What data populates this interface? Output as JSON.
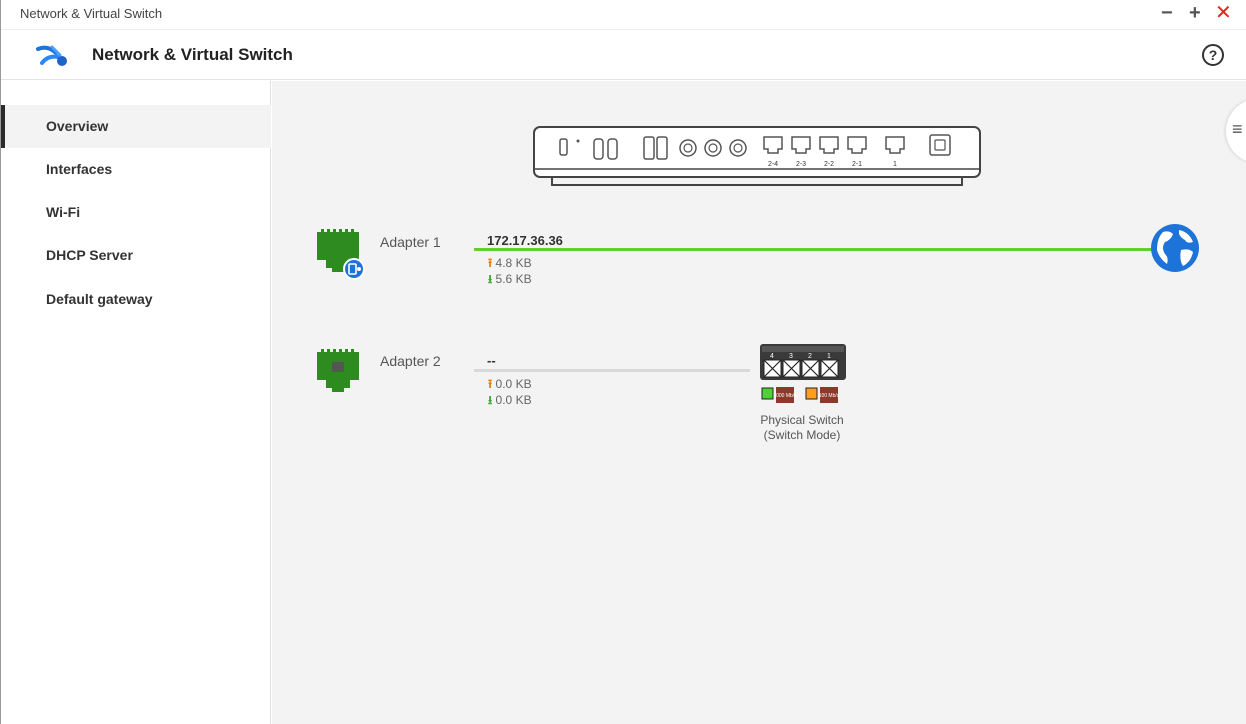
{
  "window": {
    "title": "Network & Virtual Switch",
    "minimize": "−",
    "maximize": "+",
    "close": "✕"
  },
  "header": {
    "app_title": "Network & Virtual Switch",
    "help_label": "?"
  },
  "sidebar": {
    "items": [
      {
        "label": "Overview",
        "active": true
      },
      {
        "label": "Interfaces",
        "active": false
      },
      {
        "label": "Wi-Fi",
        "active": false
      },
      {
        "label": "DHCP Server",
        "active": false
      },
      {
        "label": "Default gateway",
        "active": false
      }
    ]
  },
  "device": {
    "port_labels": [
      "2-4",
      "2-3",
      "2-2",
      "2-1",
      "1"
    ]
  },
  "adapters": [
    {
      "name": "Adapter 1",
      "ip": "172.17.36.36",
      "upload": "4.8 KB",
      "download": "5.6 KB",
      "status": "connected",
      "destination": "globe-icon"
    },
    {
      "name": "Adapter 2",
      "ip": "--",
      "upload": "0.0 KB",
      "download": "0.0 KB",
      "status": "idle",
      "destination": "physical-switch-icon"
    }
  ],
  "physical_switch": {
    "port_numbers": [
      "4",
      "3",
      "2",
      "1"
    ],
    "legend_green": "1000 Mb/s",
    "legend_orange": "100 Mb/s",
    "label_line1": "Physical Switch",
    "label_line2": "(Switch Mode)"
  },
  "icons": {
    "up_arrow": "⭱",
    "down_arrow": "⭳",
    "collapse": "≡"
  },
  "colors": {
    "accent_green": "#66cc33",
    "adapter_green": "#2e8b1f",
    "upload_orange": "#ef7d00",
    "download_green": "#3aa532",
    "globe_blue": "#1e73d8",
    "close_red": "#e1261c"
  }
}
